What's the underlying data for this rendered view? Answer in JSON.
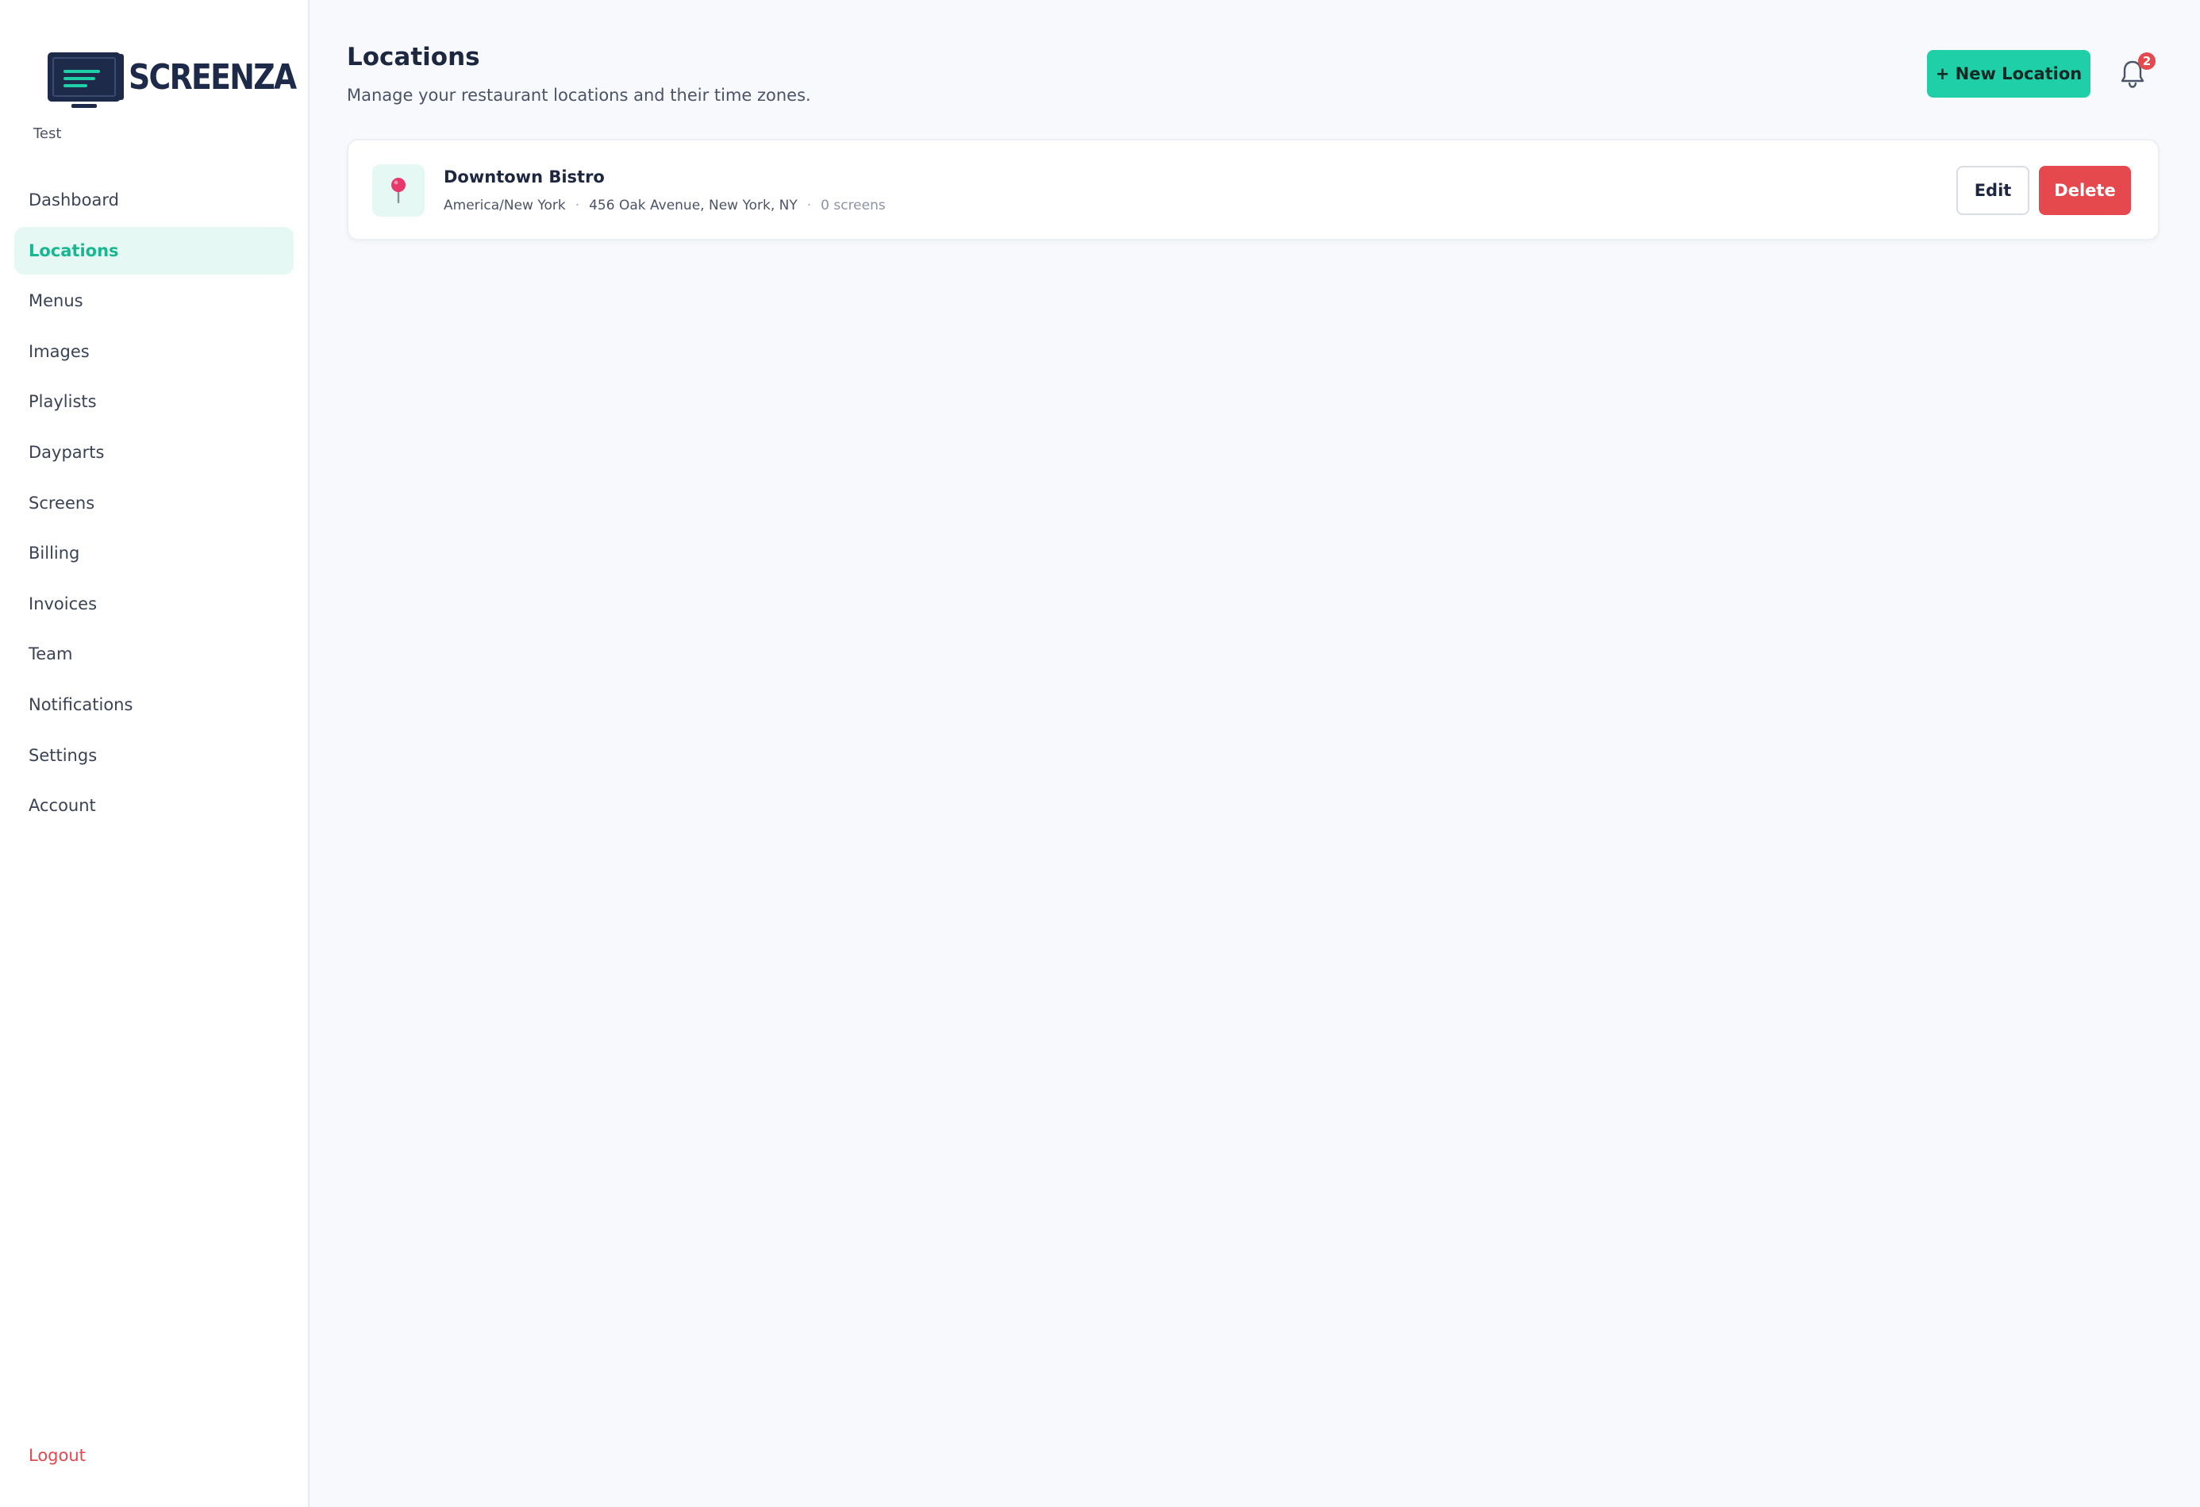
{
  "brand": {
    "name": "SCREENZA",
    "org": "Test",
    "accent": "#1fcfa8",
    "dark": "#1e2a4a"
  },
  "sidebar": {
    "items": [
      {
        "label": "Dashboard"
      },
      {
        "label": "Locations",
        "active": true
      },
      {
        "label": "Menus"
      },
      {
        "label": "Images"
      },
      {
        "label": "Playlists"
      },
      {
        "label": "Dayparts"
      },
      {
        "label": "Screens"
      },
      {
        "label": "Billing"
      },
      {
        "label": "Invoices"
      },
      {
        "label": "Team"
      },
      {
        "label": "Notifications"
      },
      {
        "label": "Settings"
      },
      {
        "label": "Account"
      }
    ],
    "logout": "Logout"
  },
  "header": {
    "title": "Locations",
    "subtitle": "Manage your restaurant locations and their time zones.",
    "new_button": "+ New Location",
    "notifications_count": "2",
    "bell_icon": "bell-icon"
  },
  "locations": [
    {
      "name": "Downtown Bistro",
      "timezone": "America/New York",
      "address": "456 Oak Avenue, New York, NY",
      "screens": "0 screens",
      "icon": "map-pin-icon",
      "edit_label": "Edit",
      "delete_label": "Delete"
    }
  ],
  "colors": {
    "active_bg": "#e6f8f3",
    "active_text": "#17b890",
    "danger": "#e5484d",
    "background": "#f7f9fc"
  }
}
